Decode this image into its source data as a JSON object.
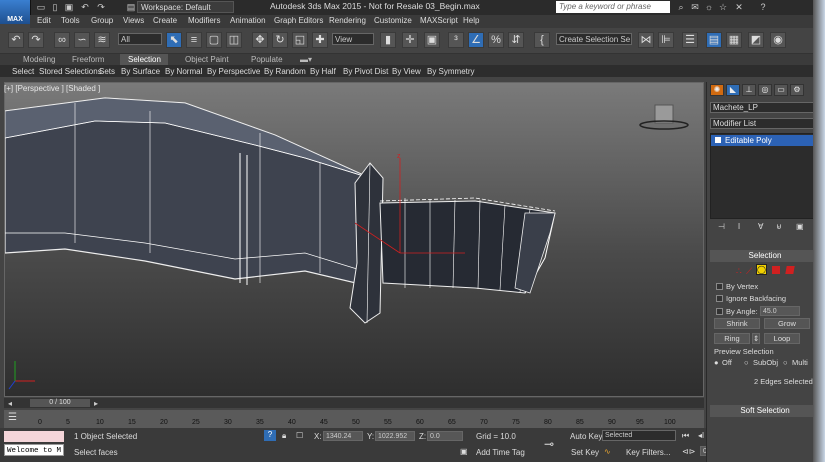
{
  "titlebar": {
    "logo_text": "MAX",
    "workspace": "Workspace: Default",
    "app_title": "Autodesk 3ds Max 2015  - Not for Resale   03_Begin.max",
    "search_placeholder": "Type a keyword or phrase"
  },
  "menus": [
    "Edit",
    "Tools",
    "Group",
    "Views",
    "Create",
    "Modifiers",
    "Animation",
    "Graph Editors",
    "Rendering",
    "Customize",
    "MAXScript",
    "Help"
  ],
  "toolbar": {
    "filter_dropdown": "All",
    "refcoord_dropdown": "View",
    "named_selection": "Create Selection Se"
  },
  "ribbon": {
    "tabs": [
      "Modeling",
      "Freeform",
      "Selection",
      "Object Paint",
      "Populate"
    ],
    "active_tab": "Selection",
    "buttons": [
      "Select",
      "Stored Selections",
      "Sets",
      "By Surface",
      "By Normal",
      "By Perspective",
      "By Random",
      "By Half",
      "By Pivot Dist",
      "By View",
      "By Symmetry"
    ]
  },
  "viewport": {
    "label": "[+] [Perspective ] [Shaded ]",
    "gizmo_label": "z"
  },
  "timeline": {
    "frame": "0 / 100",
    "ticks": [
      "0",
      "5",
      "10",
      "15",
      "20",
      "25",
      "30",
      "35",
      "40",
      "45",
      "50",
      "55",
      "60",
      "65",
      "70",
      "75",
      "80",
      "85",
      "90",
      "95",
      "100"
    ]
  },
  "status": {
    "listener": "Welcome to M",
    "selected_count": "1 Object Selected",
    "prompt": "Select faces",
    "x_label": "X:",
    "x_value": "1340.24",
    "y_label": "Y:",
    "y_value": "1022.952",
    "z_label": "Z:",
    "z_value": "0.0",
    "grid": "Grid = 10.0",
    "add_time_tag": "Add Time Tag",
    "auto_key": "Auto Key",
    "set_key": "Set Key",
    "key_dropdown": "Selected",
    "key_filters": "Key Filters...",
    "frame_field": "0"
  },
  "panel": {
    "object_name": "Machete_LP",
    "modifier_list": "Modifier List",
    "stack_item": "Editable Poly",
    "selection_title": "Selection",
    "by_vertex": "By Vertex",
    "ignore_backfacing": "Ignore Backfacing",
    "by_angle": "By Angle:",
    "angle_value": "45.0",
    "shrink": "Shrink",
    "grow": "Grow",
    "ring": "Ring",
    "loop": "Loop",
    "preview_selection": "Preview Selection",
    "preview_off": "Off",
    "preview_subobj": "SubObj",
    "preview_multi": "Multi",
    "edges_selected": "2 Edges Selected",
    "soft_selection": "Soft Selection"
  },
  "colors": {
    "accent_blue": "#2f6db5",
    "selection_red": "#d02020",
    "vertex_yellow": "#f0d000"
  }
}
